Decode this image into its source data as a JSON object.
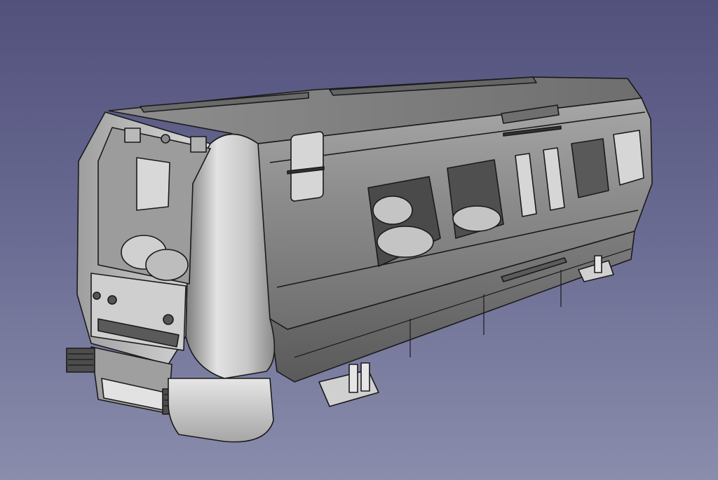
{
  "viewport": {
    "background_top": "#51517c",
    "background_bottom": "#8a8dac"
  },
  "model": {
    "icon": "train-car-3d-model",
    "body_color": "#8e8e8e",
    "roof_color": "#7f7f7f",
    "side_color": "#8d8d8d",
    "cab_color": "#c9c9c9",
    "edge_color": "#1a1a1a",
    "window_color": "#d6d6d6",
    "seat_color": "#c4c4c4"
  }
}
